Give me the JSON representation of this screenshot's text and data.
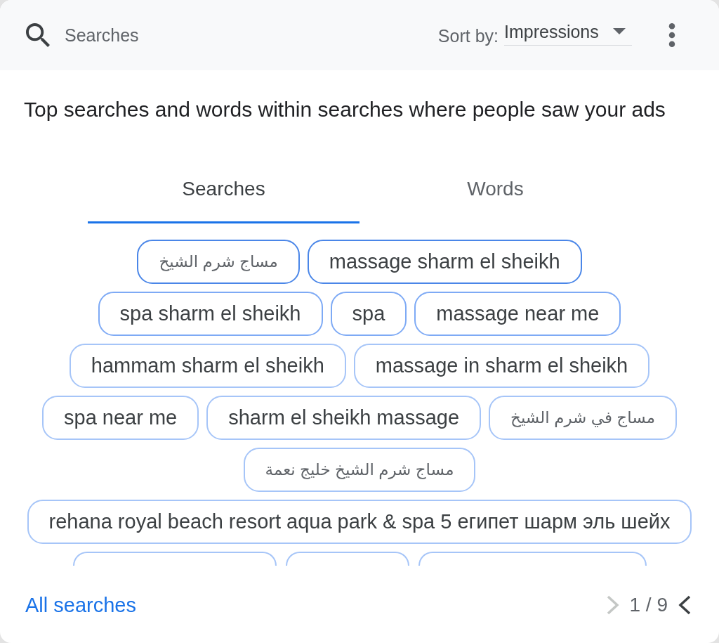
{
  "header": {
    "title": "Searches",
    "sort_label": "Sort by:",
    "sort_value": "Impressions"
  },
  "description": "Top searches and words within searches where people saw your ads",
  "tabs": [
    {
      "label": "Searches",
      "selected": true
    },
    {
      "label": "Words",
      "selected": false
    }
  ],
  "chip_rows": [
    {
      "chips": [
        {
          "label": "مساج شرم الشيخ",
          "kind": "arabic",
          "color": "#4a86e8"
        },
        {
          "label": "massage sharm el sheikh",
          "kind": "latin",
          "color": "#4a86e8"
        }
      ]
    },
    {
      "chips": [
        {
          "label": "spa sharm el sheikh",
          "kind": "latin",
          "color": "#7eaaf5"
        },
        {
          "label": "spa",
          "kind": "latin",
          "color": "#7eaaf5"
        },
        {
          "label": "massage near me",
          "kind": "latin",
          "color": "#7eaaf5"
        }
      ]
    },
    {
      "chips": [
        {
          "label": "hammam sharm el sheikh",
          "kind": "latin",
          "color": "#a6c5f8"
        },
        {
          "label": "massage in sharm el sheikh",
          "kind": "latin",
          "color": "#a6c5f8"
        }
      ]
    },
    {
      "chips": [
        {
          "label": "spa near me",
          "kind": "latin",
          "color": "#a6c5f8"
        },
        {
          "label": "sharm el sheikh massage",
          "kind": "latin",
          "color": "#a6c5f8"
        },
        {
          "label": "مساج في شرم الشيخ",
          "kind": "arabic",
          "color": "#a6c5f8"
        }
      ]
    },
    {
      "chips": [
        {
          "label": "مساج شرم الشيخ خليج نعمة",
          "kind": "arabic",
          "color": "#a6c5f8"
        }
      ]
    },
    {
      "chips": [
        {
          "label": "rehana royal beach resort aqua park & spa 5 египет шарм эль шейх",
          "kind": "latin",
          "color": "#a6c5f8"
        }
      ]
    }
  ],
  "cut_off_chips": [
    {
      "color": "#a6c5f8"
    },
    {
      "color": "#a6c5f8"
    },
    {
      "color": "#a6c5f8"
    }
  ],
  "footer": {
    "link": "All searches",
    "page": "1 / 9",
    "pager": [
      {
        "kind": "right",
        "disabled": true
      },
      {
        "kind": "left",
        "disabled": false
      }
    ]
  }
}
